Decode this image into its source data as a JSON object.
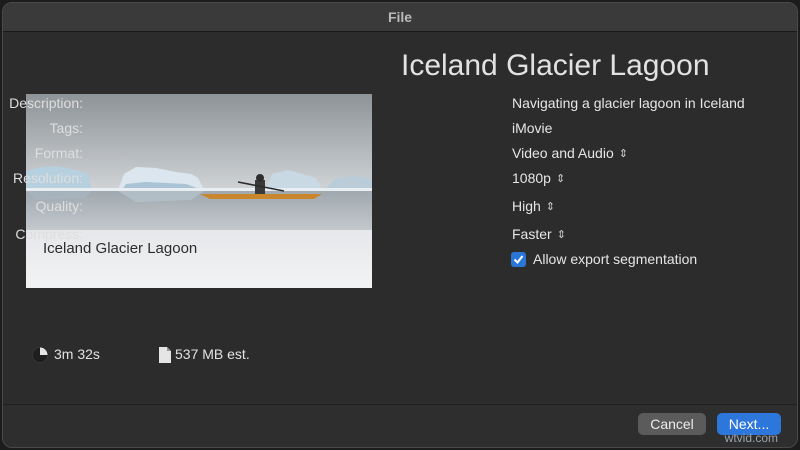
{
  "window": {
    "title": "File"
  },
  "preview": {
    "caption": "Iceland Glacier Lagoon"
  },
  "export": {
    "title": "Iceland Glacier Lagoon",
    "fields": [
      {
        "label": "Description:",
        "value": "Navigating a glacier lagoon in Iceland"
      },
      {
        "label": "Tags:",
        "value": "iMovie"
      },
      {
        "label": "Format:",
        "value": "Video and Audio"
      },
      {
        "label": "Resolution:",
        "value": "1080p"
      },
      {
        "label": "Quality:",
        "value": "High"
      },
      {
        "label": "Compress:",
        "value": "Faster"
      }
    ],
    "segmentation": {
      "label": "Allow export segmentation",
      "checked": true
    }
  },
  "stats": {
    "duration": {
      "icon": "clock-icon",
      "text": "3m 32s"
    },
    "size": {
      "icon": "document-icon",
      "text": "537 MB est."
    }
  },
  "buttons": {
    "cancel": "Cancel",
    "next": "Next..."
  },
  "colors": {
    "accent": "#2d77dc",
    "background": "#2c2c2c"
  },
  "watermark": "wtvid.com"
}
